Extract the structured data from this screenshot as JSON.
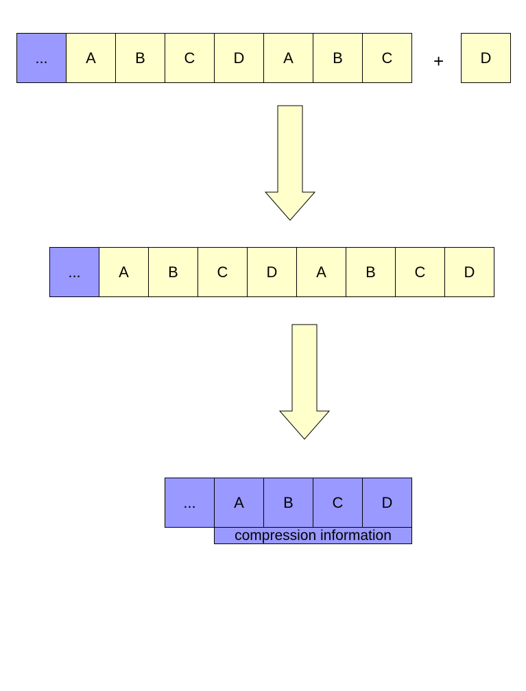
{
  "diagram": {
    "row1": {
      "cells": [
        {
          "label": "...",
          "color": "#9999ff"
        },
        {
          "label": "A",
          "color": "#ffffcc"
        },
        {
          "label": "B",
          "color": "#ffffcc"
        },
        {
          "label": "C",
          "color": "#ffffcc"
        },
        {
          "label": "D",
          "color": "#ffffcc"
        },
        {
          "label": "A",
          "color": "#ffffcc"
        },
        {
          "label": "B",
          "color": "#ffffcc"
        },
        {
          "label": "C",
          "color": "#ffffcc"
        }
      ],
      "operator": "+",
      "appended": {
        "label": "D",
        "color": "#ffffcc"
      }
    },
    "row2": {
      "cells": [
        {
          "label": "...",
          "color": "#9999ff"
        },
        {
          "label": "A",
          "color": "#ffffcc"
        },
        {
          "label": "B",
          "color": "#ffffcc"
        },
        {
          "label": "C",
          "color": "#ffffcc"
        },
        {
          "label": "D",
          "color": "#ffffcc"
        },
        {
          "label": "A",
          "color": "#ffffcc"
        },
        {
          "label": "B",
          "color": "#ffffcc"
        },
        {
          "label": "C",
          "color": "#ffffcc"
        },
        {
          "label": "D",
          "color": "#ffffcc"
        }
      ]
    },
    "row3": {
      "cells": [
        {
          "label": "...",
          "color": "#9999ff"
        },
        {
          "label": "A",
          "color": "#9999ff"
        },
        {
          "label": "B",
          "color": "#9999ff"
        },
        {
          "label": "C",
          "color": "#9999ff"
        },
        {
          "label": "D",
          "color": "#9999ff"
        }
      ],
      "caption": "compression information"
    },
    "arrow_color": "#ffffcc"
  }
}
